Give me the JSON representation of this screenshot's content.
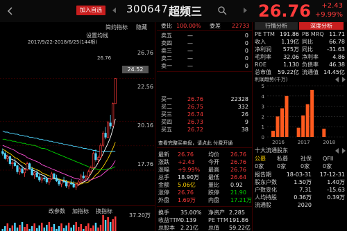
{
  "header": {
    "add_label": "加入自选",
    "code": "300647",
    "name": "超频三",
    "price": "26.76",
    "change": "+2.43",
    "change_pct": "+9.99%"
  },
  "chart_tabs": [
    "简约指标",
    "隐藏"
  ],
  "chart_info": {
    "indicator_title": "设置均线",
    "date_range": "2017/9/22-2018/6/25(144根)",
    "last_price": "26.76"
  },
  "price_axis": [
    "26.76",
    "24.52",
    "22.56",
    "20.16",
    "17.76"
  ],
  "price_axis_bottom": "37.20万",
  "chart_bottom_tabs": [
    "改参数",
    "加指标",
    "换指标"
  ],
  "commission": {
    "ratio_label": "委比",
    "ratio": "100.00%",
    "diff_label": "委差",
    "diff": "22733"
  },
  "sells": [
    {
      "label": "卖五",
      "price": "—",
      "vol": "0"
    },
    {
      "label": "卖四",
      "price": "—",
      "vol": "0"
    },
    {
      "label": "卖三",
      "price": "—",
      "vol": "0"
    },
    {
      "label": "卖二",
      "price": "—",
      "vol": "0"
    },
    {
      "label": "卖一",
      "price": "—",
      "vol": "0"
    }
  ],
  "buys": [
    {
      "label": "买一",
      "price": "26.76",
      "vol": "22328"
    },
    {
      "label": "买二",
      "price": "26.75",
      "vol": "332"
    },
    {
      "label": "买三",
      "price": "26.74",
      "vol": "26"
    },
    {
      "label": "买四",
      "price": "26.73",
      "vol": "9"
    },
    {
      "label": "买五",
      "price": "26.72",
      "vol": "38"
    }
  ],
  "order_note": "查看完整买卖盘，请点此 付费开通",
  "quote": [
    {
      "l1": "最新",
      "v1": "26.76",
      "l2": "均价",
      "v2": "26.76"
    },
    {
      "l1": "涨跌",
      "v1": "+2.43",
      "l2": "今开",
      "v2": "26.76"
    },
    {
      "l1": "涨幅",
      "v1": "+9.99%",
      "l2": "最高",
      "v2": "26.76"
    },
    {
      "l1": "总手",
      "v1": "18.90万",
      "l2": "最低",
      "v2": "26.64"
    },
    {
      "l1": "金额",
      "v1": "5.06亿",
      "l2": "量比",
      "v2": "0.92"
    },
    {
      "l1": "涨停",
      "v1": "26.76",
      "l2": "跌停",
      "v2": "21.90"
    },
    {
      "l1": "外盘",
      "v1": "1.69万",
      "l2": "内盘",
      "v2": "17.21万"
    }
  ],
  "bottom_stats": [
    {
      "l1": "换手",
      "v1": "35.00%",
      "l2": "净资产",
      "v2": "2.285"
    },
    {
      "l1": "收益TTM",
      "v1": "0.139",
      "l2": "PE TTM",
      "v2": "191.86"
    },
    {
      "l1": "总股本",
      "v1": "2.21亿",
      "l2": "总值",
      "v2": "59.22亿"
    },
    {
      "l1": "流通股",
      "v1": "5400万",
      "l2": "流通值",
      "v2": "14.45亿"
    }
  ],
  "right_tabs": [
    "行情分析",
    "深度分析"
  ],
  "fundamentals": [
    {
      "l1": "PE TTM",
      "v1": "191.86",
      "l2": "PB MRQ",
      "v2": "11.71"
    },
    {
      "l1": "收入",
      "v1": "1.19亿",
      "l2": "同比",
      "v2": "66.78"
    },
    {
      "l1": "净利润",
      "v1": "575万",
      "l2": "同比",
      "v2": "-31.63"
    },
    {
      "l1": "毛利率",
      "v1": "32.06",
      "l2": "净利率",
      "v2": "4.86"
    },
    {
      "l1": "ROE",
      "v1": "1.130",
      "l2": "负债率",
      "v2": "46.38"
    },
    {
      "l1": "总市值",
      "v1": "59.22亿",
      "l2": "流通值",
      "v2": "14.45亿"
    }
  ],
  "profit_chart": {
    "title": "利润趋势(千万)",
    "years": [
      "2016",
      "2017",
      "2018"
    ],
    "ylabels": [
      "5",
      "4",
      "3",
      "2",
      "1",
      "0"
    ]
  },
  "holders": {
    "title": "十大流通股东",
    "cols": [
      "公募",
      "私募",
      "社保",
      "QFII"
    ],
    "counts": [
      "0家",
      "0家",
      "0家",
      "0家"
    ],
    "rows": [
      {
        "l1": "报告期",
        "v1": "18-03-31",
        "v2": "17-12-31"
      },
      {
        "l1": "股东户数",
        "v1": "1.50万",
        "v2": "1.40万"
      },
      {
        "l1": "户数变化",
        "v1": "7.31",
        "v2": "-15.63"
      },
      {
        "l1": "人均持股",
        "v1": "0.36万",
        "v2": "0.39万"
      },
      {
        "l1": "流通股",
        "v1": "2020",
        "v2": ""
      }
    ]
  },
  "chart_data": {
    "type": "candlestick",
    "ylim": [
      14.5,
      28.5
    ],
    "candles": [
      [
        19.6,
        19.9,
        19.2,
        19.4
      ],
      [
        19.4,
        19.6,
        18.8,
        18.9
      ],
      [
        18.9,
        19.3,
        18.6,
        19.1
      ],
      [
        19.1,
        19.2,
        18.2,
        18.4
      ],
      [
        18.4,
        18.7,
        17.9,
        18.5
      ],
      [
        18.5,
        18.9,
        18.1,
        18.2
      ],
      [
        18.2,
        18.3,
        17.4,
        17.6
      ],
      [
        17.6,
        18.1,
        17.3,
        17.9
      ],
      [
        17.9,
        18.2,
        17.4,
        17.5
      ],
      [
        17.5,
        17.9,
        17.1,
        17.8
      ],
      [
        17.8,
        18.6,
        17.7,
        18.4
      ],
      [
        18.4,
        18.5,
        17.8,
        17.9
      ],
      [
        17.9,
        18.1,
        17.2,
        17.3
      ],
      [
        17.3,
        17.6,
        16.9,
        17.5
      ],
      [
        17.5,
        17.8,
        17.0,
        17.1
      ],
      [
        17.1,
        17.4,
        16.6,
        16.8
      ],
      [
        16.8,
        17.2,
        16.5,
        17.0
      ],
      [
        17.0,
        17.3,
        16.7,
        16.9
      ],
      [
        16.9,
        17.1,
        16.4,
        16.6
      ],
      [
        16.6,
        17.0,
        16.3,
        16.9
      ],
      [
        16.9,
        17.6,
        16.8,
        17.4
      ],
      [
        17.4,
        17.5,
        16.9,
        17.0
      ],
      [
        17.0,
        17.3,
        16.6,
        16.7
      ],
      [
        16.7,
        16.9,
        16.2,
        16.4
      ],
      [
        16.4,
        16.8,
        16.1,
        16.7
      ],
      [
        16.7,
        17.1,
        16.5,
        16.6
      ],
      [
        16.6,
        16.8,
        16.0,
        16.2
      ],
      [
        16.2,
        16.6,
        15.9,
        16.5
      ],
      [
        16.5,
        16.9,
        16.3,
        16.4
      ],
      [
        16.4,
        16.7,
        16.0,
        16.1
      ],
      [
        16.1,
        16.5,
        15.8,
        16.4
      ],
      [
        16.4,
        16.8,
        16.2,
        16.6
      ],
      [
        16.6,
        17.4,
        16.5,
        17.2
      ],
      [
        17.2,
        17.6,
        16.9,
        17.0
      ],
      [
        17.0,
        17.3,
        16.7,
        17.1
      ],
      [
        17.1,
        17.8,
        17.0,
        17.6
      ],
      [
        17.6,
        18.2,
        17.4,
        18.0
      ],
      [
        18.0,
        19.6,
        17.9,
        19.4
      ],
      [
        19.4,
        19.8,
        18.6,
        18.8
      ],
      [
        18.8,
        19.2,
        18.4,
        19.0
      ],
      [
        19.0,
        20.4,
        18.9,
        20.2
      ],
      [
        20.2,
        21.6,
        20.0,
        21.4
      ],
      [
        21.4,
        22.0,
        20.8,
        21.0
      ],
      [
        21.0,
        22.6,
        20.9,
        22.4
      ],
      [
        22.4,
        23.2,
        21.8,
        22.1
      ],
      [
        22.1,
        24.4,
        22.0,
        24.3
      ],
      [
        24.3,
        26.76,
        24.3,
        26.76
      ]
    ],
    "ma": [
      {
        "name": "MA5",
        "color": "#ffffff",
        "values": [
          19.6,
          19.3,
          19.1,
          18.9,
          18.8,
          18.7,
          18.5,
          18.3,
          18.1,
          17.9,
          17.9,
          17.9,
          17.8,
          17.7,
          17.6,
          17.4,
          17.3,
          17.2,
          17.0,
          16.9,
          16.9,
          16.9,
          16.9,
          16.8,
          16.8,
          16.7,
          16.6,
          16.5,
          16.5,
          16.4,
          16.3,
          16.3,
          16.5,
          16.6,
          16.7,
          17.0,
          17.4,
          17.8,
          18.1,
          18.5,
          18.9,
          19.4,
          19.9,
          20.4,
          21.0,
          21.8,
          22.8
        ]
      },
      {
        "name": "MA10",
        "color": "#ffd200",
        "values": [
          19.8,
          19.7,
          19.5,
          19.4,
          19.2,
          19.0,
          18.9,
          18.7,
          18.5,
          18.4,
          18.2,
          18.1,
          18.0,
          17.9,
          17.8,
          17.7,
          17.5,
          17.4,
          17.3,
          17.2,
          17.1,
          17.0,
          16.9,
          16.9,
          16.8,
          16.8,
          16.7,
          16.6,
          16.6,
          16.5,
          16.5,
          16.4,
          16.4,
          16.5,
          16.5,
          16.6,
          16.8,
          17.0,
          17.3,
          17.5,
          17.8,
          18.1,
          18.5,
          18.9,
          19.4,
          19.9,
          20.5
        ]
      },
      {
        "name": "MA20",
        "color": "#ff4fd8",
        "values": [
          20.2,
          20.1,
          20.0,
          19.9,
          19.8,
          19.7,
          19.5,
          19.4,
          19.3,
          19.2,
          19.0,
          18.9,
          18.8,
          18.7,
          18.6,
          18.5,
          18.3,
          18.2,
          18.1,
          18.0,
          17.9,
          17.8,
          17.7,
          17.6,
          17.5,
          17.4,
          17.3,
          17.2,
          17.1,
          17.0,
          16.9,
          16.9,
          16.8,
          16.8,
          16.8,
          16.8,
          16.8,
          16.9,
          17.0,
          17.1,
          17.2,
          17.4,
          17.6,
          17.8,
          18.0,
          18.3,
          18.7
        ]
      },
      {
        "name": "MA60",
        "color": "#00d200",
        "values": [
          20.8,
          20.8,
          20.7,
          20.7,
          20.6,
          20.6,
          20.5,
          20.5,
          20.4,
          20.4,
          20.3,
          20.3,
          20.2,
          20.2,
          20.1,
          20.0,
          19.9,
          19.9,
          19.8,
          19.7,
          19.6,
          19.5,
          19.4,
          19.3,
          19.2,
          19.1,
          19.0,
          18.9,
          18.8,
          18.7,
          18.6,
          18.5,
          18.4,
          18.3,
          18.2,
          18.1,
          18.0,
          17.9,
          17.9,
          17.8,
          17.8,
          17.8,
          17.8,
          17.9,
          17.9,
          18.0,
          18.1
        ]
      },
      {
        "name": "MA120",
        "color": "#4fd6ff",
        "values": [
          21.6,
          21.5,
          21.5,
          21.4,
          21.4,
          21.3,
          21.3,
          21.2,
          21.2,
          21.1,
          21.1,
          21.0,
          21.0,
          20.9,
          20.9,
          20.8,
          20.8,
          20.7,
          20.7,
          20.6,
          20.6,
          20.5,
          20.5,
          20.4,
          20.4,
          20.3,
          20.3,
          20.2,
          20.2,
          20.1,
          20.1,
          20.0,
          20.0,
          19.9,
          19.9,
          19.8,
          19.8,
          19.7,
          19.7,
          19.6,
          19.6,
          19.6,
          19.6,
          19.6,
          19.6,
          19.6,
          19.6
        ]
      }
    ],
    "profit_bars": [
      {
        "year": "2016",
        "values": [
          0.6,
          2.0,
          2.8,
          4.0
        ]
      },
      {
        "year": "2017",
        "values": [
          0.9,
          2.1,
          3.2,
          4.6
        ]
      },
      {
        "year": "2018",
        "values": [
          0.8
        ]
      }
    ],
    "profit_ylim": [
      0,
      5
    ]
  }
}
